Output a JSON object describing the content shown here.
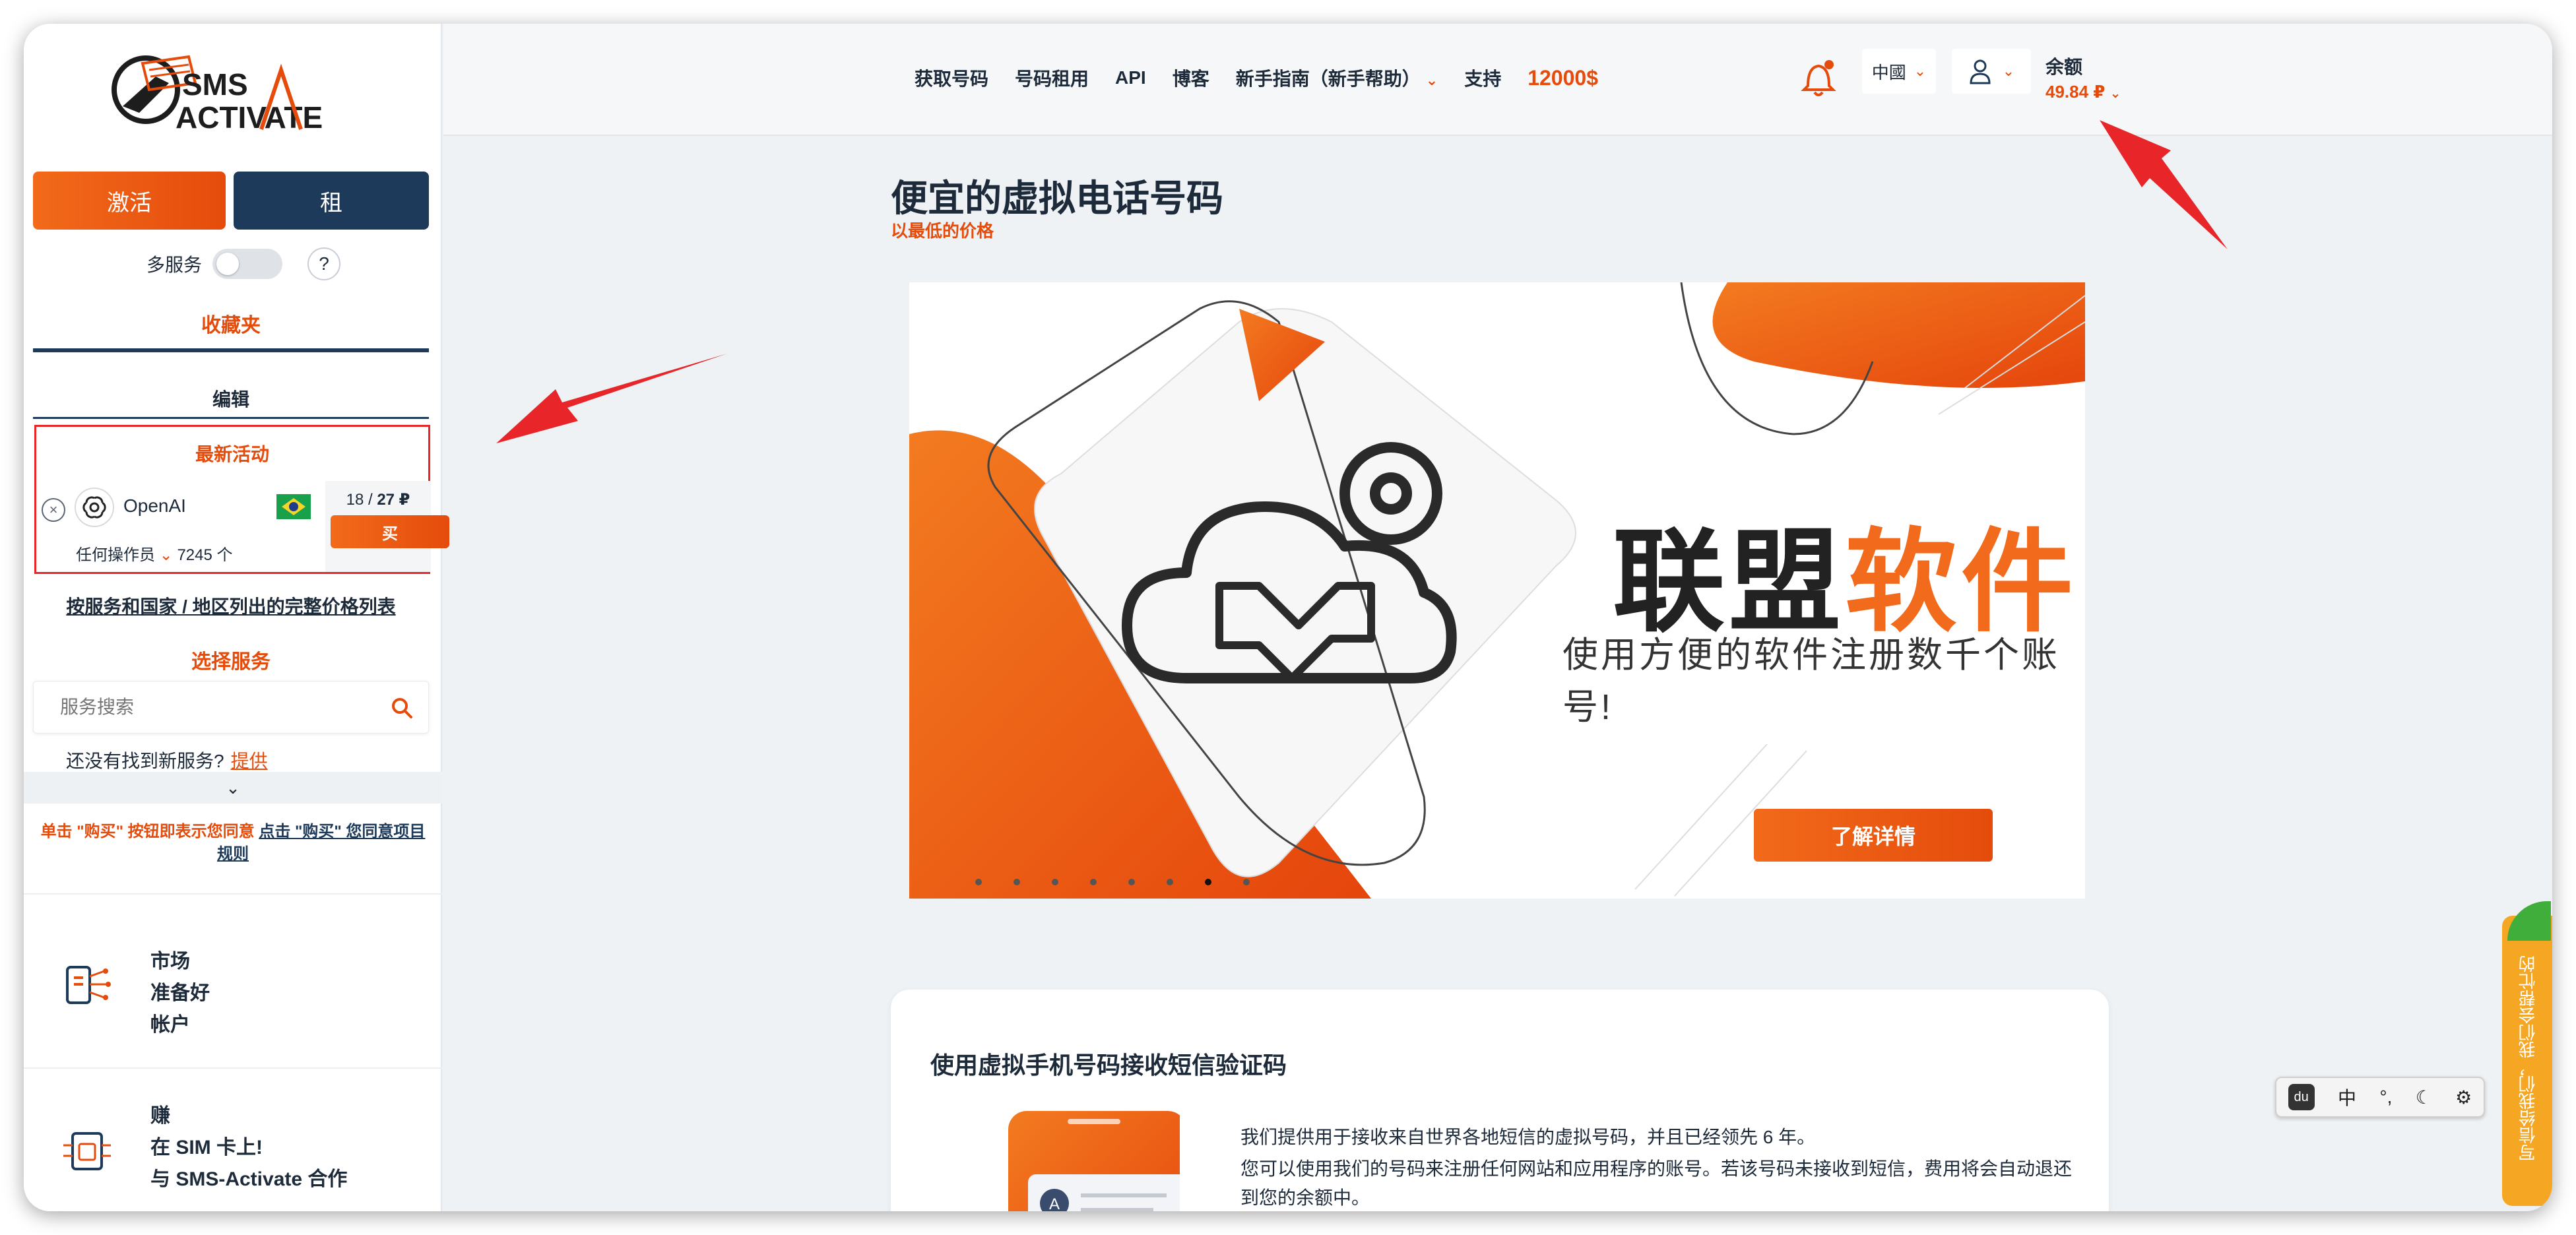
{
  "logo": {
    "line1": "SMS",
    "line2": "ACTIVATE"
  },
  "sidebar": {
    "activate_label": "激活",
    "rent_label": "租",
    "multi_service_label": "多服务",
    "help_label": "?",
    "favorites_label": "收藏夹",
    "edit_label": "编辑",
    "recent": {
      "title": "最新活动",
      "service_name": "OpenAI",
      "price_left": "18 / ",
      "price_right": "27 ₽",
      "buy_label": "买",
      "operator_label": "任何操作员",
      "count_label": "7245 个"
    },
    "full_price_list": "按服务和国家 / 地区列出的完整价格列表",
    "choose_service": "选择服务",
    "search_placeholder": "服务搜索",
    "not_found_text": "还没有找到新服务?",
    "not_found_link": "提供",
    "agree_text_1": "单击 \"购买\" 按钮即表示您同意",
    "agree_link": "点击 \"购买\" 您同意项目",
    "agree_text_2": "规则",
    "promo1": [
      "市场",
      "准备好",
      "帐户"
    ],
    "promo2": [
      "赚",
      "在 SIM 卡上!",
      "与 SMS-Activate 合作"
    ]
  },
  "header": {
    "nav": [
      "获取号码",
      "号码租用",
      "API",
      "博客",
      "新手指南（新手帮助）",
      "支持"
    ],
    "promo_amount": "12000$",
    "language": "中國",
    "balance_label": "余额",
    "balance_value": "49.84 ₽"
  },
  "main": {
    "title": "便宜的虚拟电话号码",
    "subtitle": "以最低的价格",
    "banner": {
      "title_dark": "联盟",
      "title_highlight": "软件",
      "subtitle": "使用方便的软件注册数千个账号!",
      "button": "了解详情"
    },
    "card": {
      "title": "使用虚拟手机号码接收短信验证码",
      "p1": "我们提供用于接收来自世界各地短信的虚拟号码，并且已经领先 6 年。",
      "p2": "您可以使用我们的号码来注册任何网站和应用程序的账号。若该号码未接收到短信，费用将会自动退还到您的余额中。"
    }
  },
  "ime": {
    "du": "du",
    "zh": "中",
    "punct": "°,",
    "moon": "☾",
    "gear": "⚙"
  },
  "sidetab": {
    "text": "写信给我们，我们会帮忙的"
  },
  "colors": {
    "accent": "#e54c0c",
    "navy": "#1d3a5a",
    "annotation": "#e8262a"
  }
}
